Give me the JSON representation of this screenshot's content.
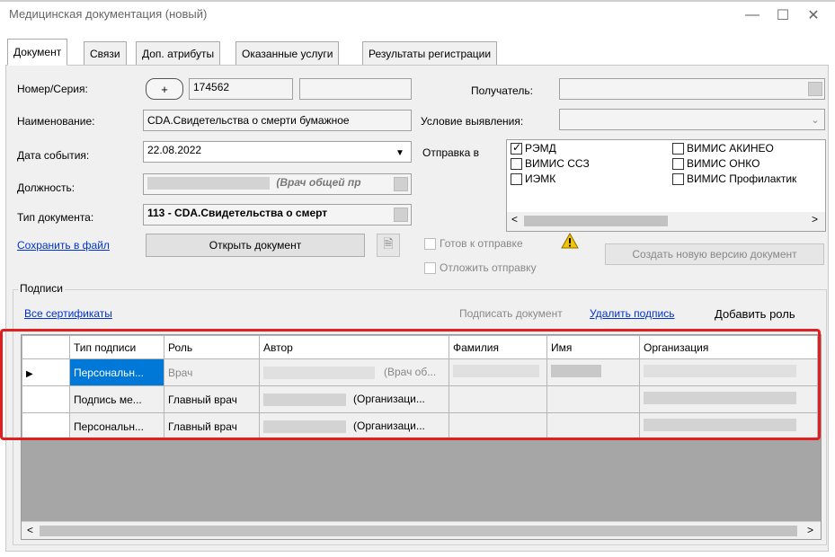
{
  "window": {
    "title": "Медицинская документация (новый)",
    "minimize_glyph": "—",
    "maximize_glyph": "☐",
    "close_glyph": "✕"
  },
  "tabs": [
    {
      "label": "Документ",
      "active": true
    },
    {
      "label": "Связи"
    },
    {
      "label": "Доп. атрибуты"
    },
    {
      "label": "Оказанные услуги"
    },
    {
      "label": "Результаты регистрации"
    }
  ],
  "form": {
    "number_label": "Номер/Серия:",
    "number_plus": "+",
    "number_value": "174562",
    "name_label": "Наименование:",
    "name_value": "CDA.Свидетельства о смерти бумажное",
    "date_label": "Дата события:",
    "date_value": "22.08.2022",
    "position_label": "Должность:",
    "position_value": "(Врач общей пр",
    "doctype_label": "Тип документа:",
    "doctype_value": "113 - CDA.Свидетельства о смерт",
    "save_link": "Сохранить в файл",
    "open_button": "Открыть документ",
    "recipient_label": "Получатель:",
    "condition_label": "Условие выявления:",
    "send_label": "Отправка в",
    "send_items_col1": [
      {
        "label": "РЭМД",
        "checked": true
      },
      {
        "label": "ВИМИС ССЗ",
        "checked": false
      },
      {
        "label": "ИЭМК",
        "checked": false
      }
    ],
    "send_items_col2": [
      {
        "label": "ВИМИС АКИНЕО",
        "checked": false
      },
      {
        "label": "ВИМИС ОНКО",
        "checked": false
      },
      {
        "label": "ВИМИС Профилактик",
        "checked": false
      }
    ],
    "ready_label": "Готов к отправке",
    "postpone_label": "Отложить отправку",
    "new_version_button": "Создать новую версию документ"
  },
  "signatures": {
    "group_label": "Подписи",
    "all_certs_link": "Все сертификаты",
    "sign_doc": "Подписать документ",
    "delete_sign_link": "Удалить подпись",
    "add_role": "Добавить роль",
    "columns": [
      "Тип подписи",
      "Роль",
      "Автор",
      "Фамилия",
      "Имя",
      "Организация"
    ],
    "rows": [
      {
        "type": "Персональн...",
        "role": "Врач",
        "author": "(Врач об...",
        "selected": true
      },
      {
        "type": "Подпись ме...",
        "role": "Главный врач",
        "author": "(Организаци..."
      },
      {
        "type": "Персональн...",
        "role": "Главный врач",
        "author": "(Организаци..."
      }
    ]
  },
  "scroll": {
    "left_arrow": "<",
    "right_arrow": ">"
  },
  "colors": {
    "highlight": "#e02020",
    "selected_cell": "#0078d7",
    "link": "#0033cc"
  }
}
